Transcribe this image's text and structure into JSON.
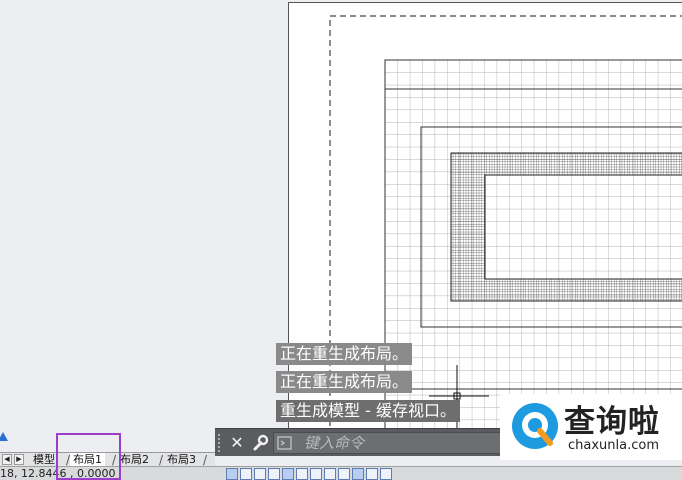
{
  "command_history": [
    "正在重生成布局。",
    "正在重生成布局。",
    "重生成模型 - 缓存视口。"
  ],
  "command_bar": {
    "placeholder": "键入命令",
    "close_label": "✕"
  },
  "layout_tabs": {
    "nav_prev_label": "◀",
    "nav_next_label": "▶",
    "items": [
      {
        "label": "模型"
      },
      {
        "label": "布局1"
      },
      {
        "label": "布局2"
      },
      {
        "label": "布局3"
      }
    ],
    "active": "布局1"
  },
  "status_bar": {
    "coordinates": "18, 12.8446 , 0.0000"
  },
  "watermark": {
    "title": "查询啦",
    "url": "chaxunla.com"
  },
  "colors": {
    "highlight": "#9b3ec9",
    "logo_blue": "#1e9be0",
    "logo_orange": "#f39a1f"
  }
}
